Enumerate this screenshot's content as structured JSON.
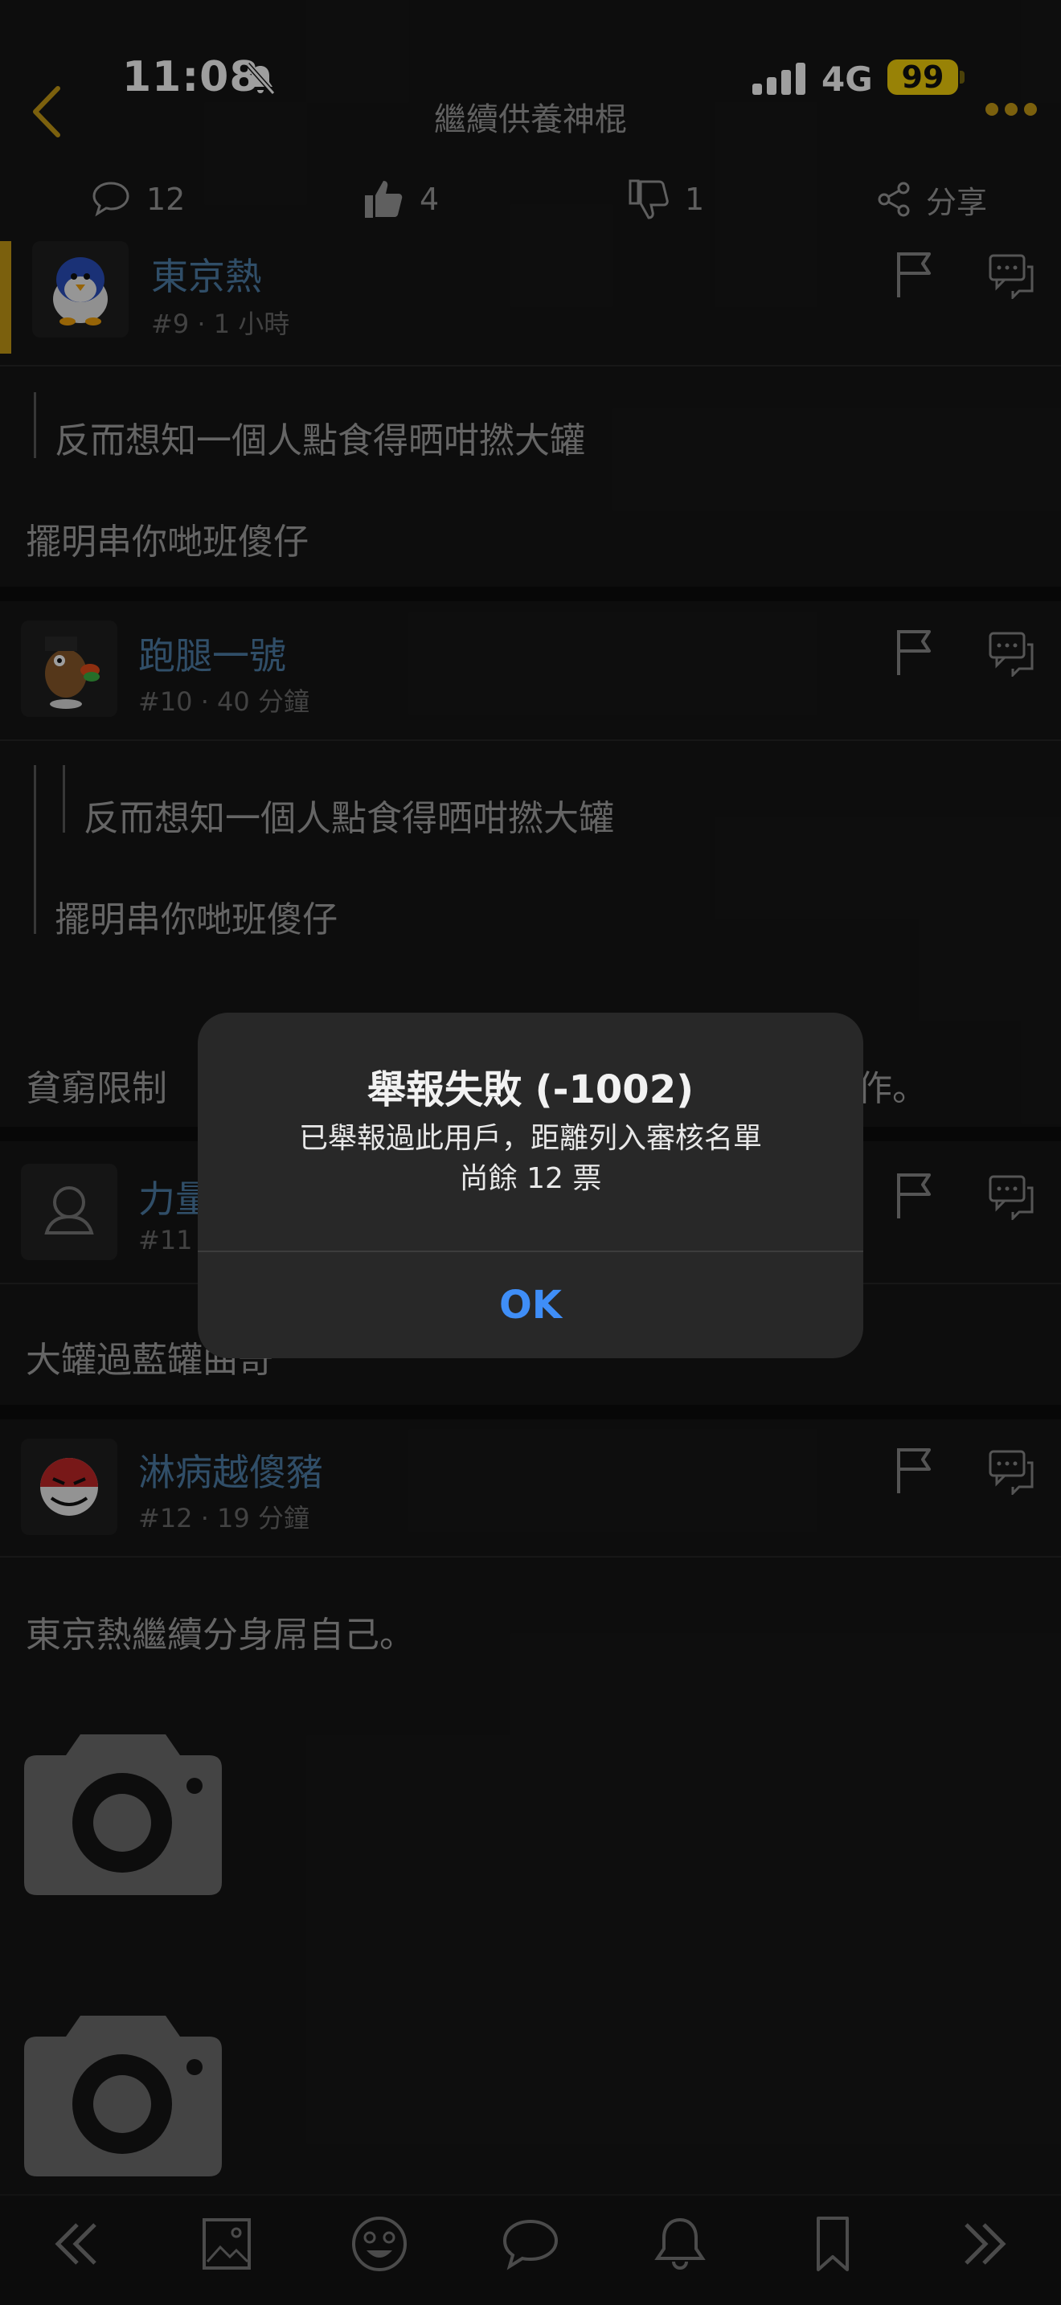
{
  "status_bar": {
    "time": "11:08",
    "network": "4G",
    "battery": "99"
  },
  "nav": {
    "title": "繼續供養神棍"
  },
  "actions": {
    "comments": "12",
    "likes": "4",
    "dislikes": "1",
    "share": "分享"
  },
  "posts": [
    {
      "username": "東京熱",
      "meta": "#9 · 1 小時",
      "quote": "反而想知一個人點食得晒咁撚大罐",
      "text": "擺明串你哋班傻仔"
    },
    {
      "username": "跑腿一號",
      "meta": "#10 · 40 分鐘",
      "nested_quote": "反而想知一個人點食得晒咁撚大罐",
      "quote": "擺明串你哋班傻仔",
      "text_start": "貧窮限制",
      "text_end": "作。"
    },
    {
      "username": "力量",
      "meta": "#11",
      "text": "大罐過藍罐曲奇"
    },
    {
      "username": "淋病越傻豬",
      "meta": "#12 · 19 分鐘",
      "text": "東京熱繼續分身屌自己。"
    }
  ],
  "alert": {
    "title": "舉報失敗 (-1002)",
    "message_line1": "已舉報過此用戶，距離列入審核名單",
    "message_line2": "尚餘 12 票",
    "ok": "OK"
  },
  "colors": {
    "accent": "#c79b16",
    "username": "#4e7ea8",
    "alert_button": "#3f8ef7",
    "battery": "#f5d20a"
  }
}
